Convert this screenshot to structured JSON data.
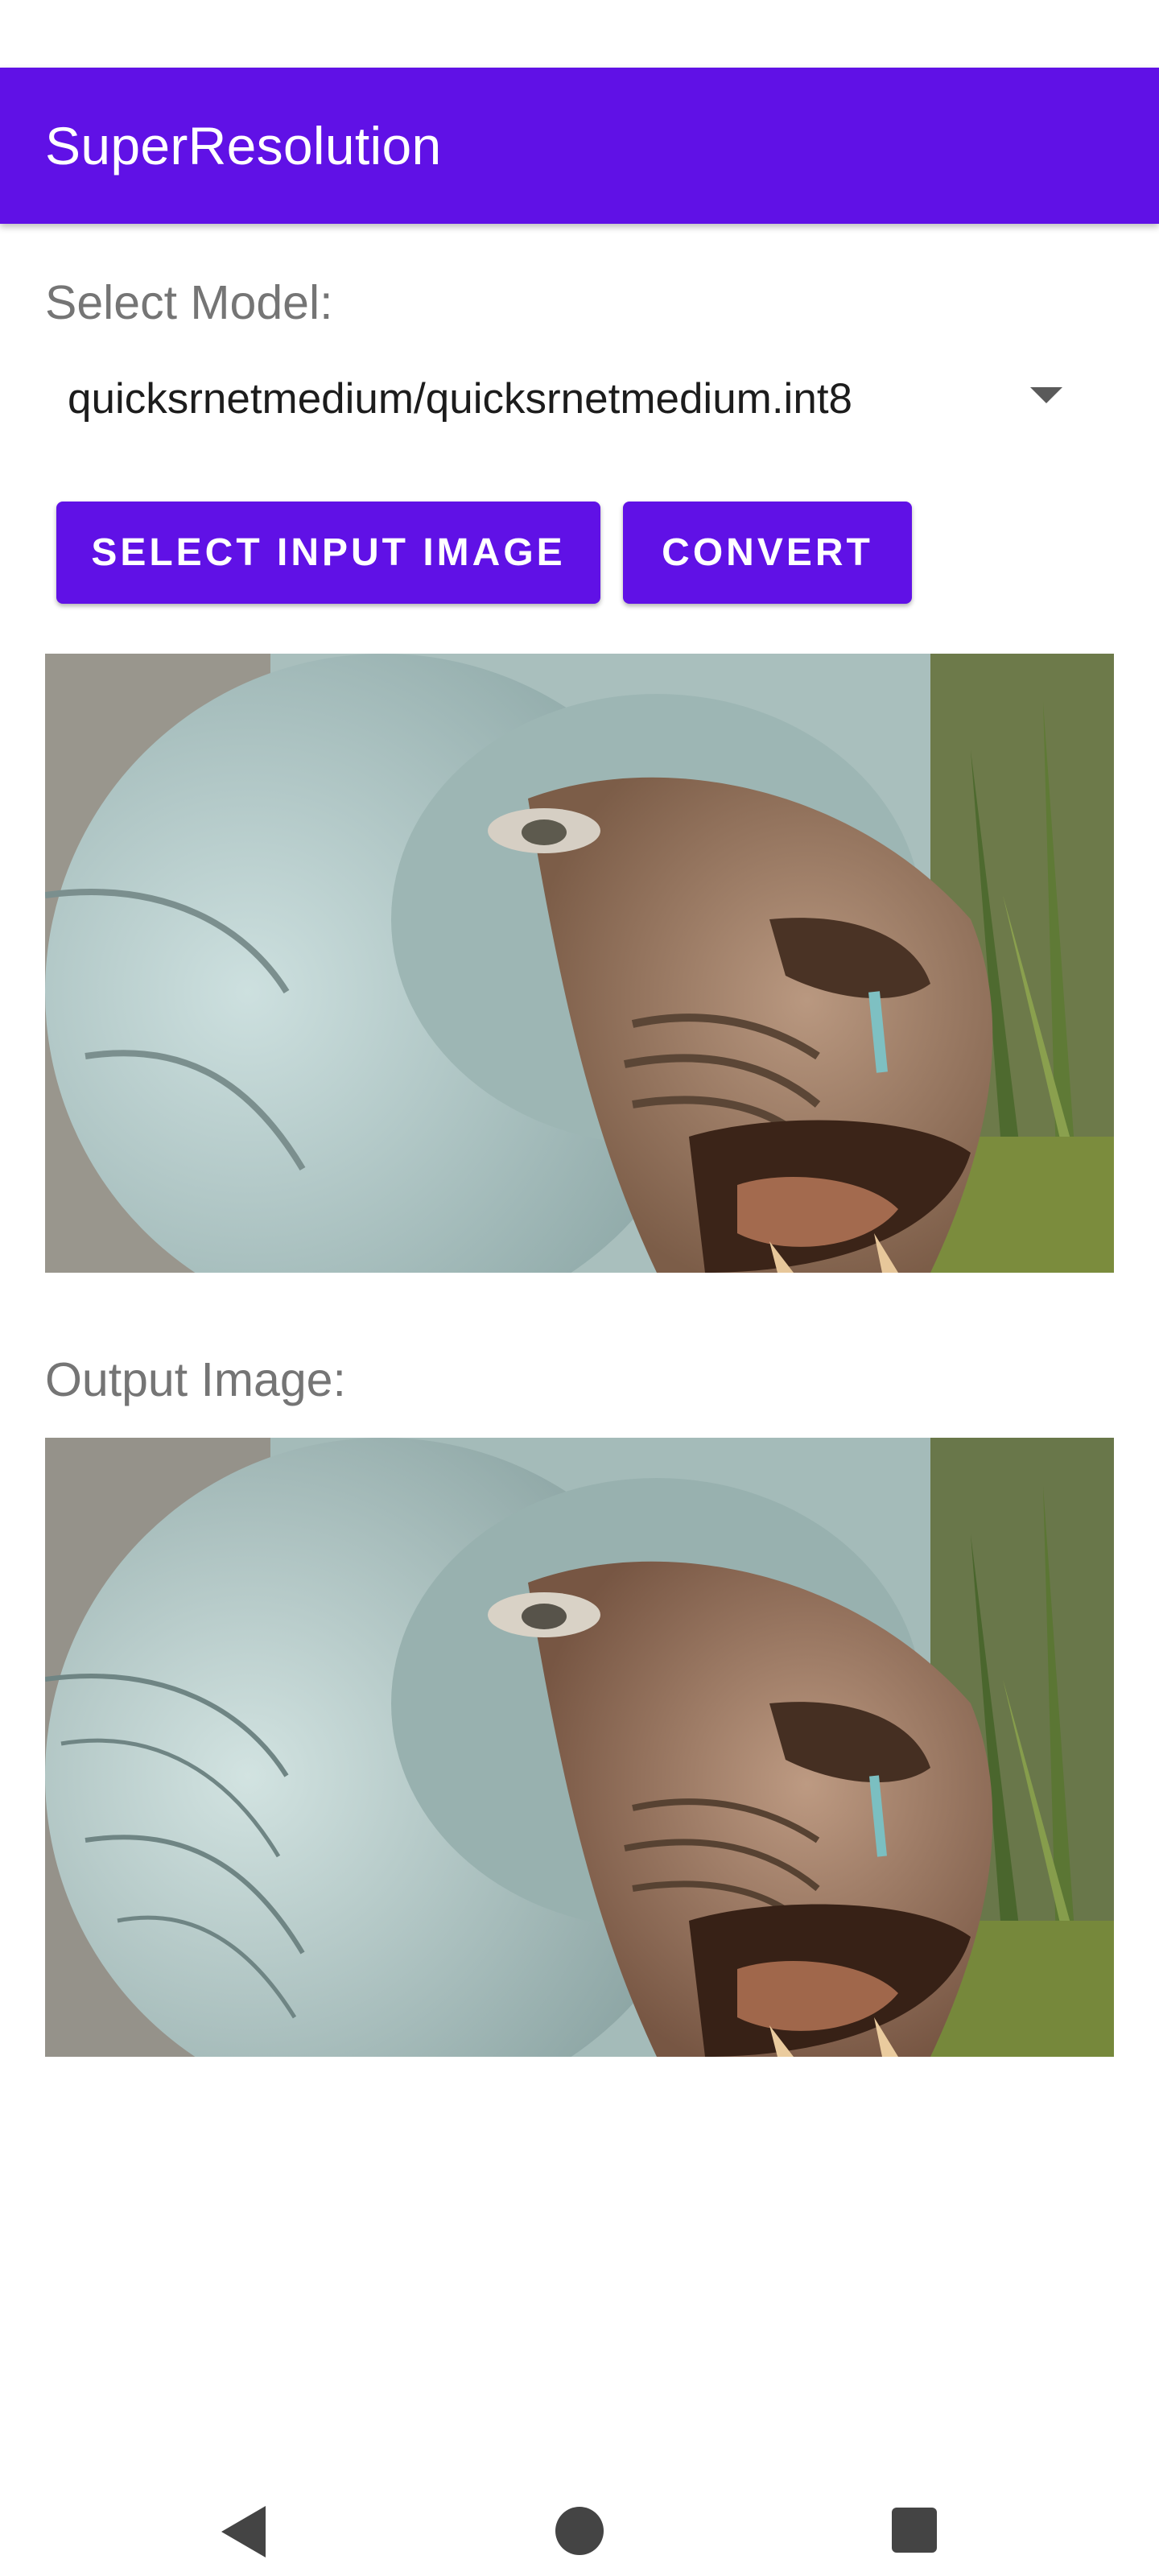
{
  "app_bar": {
    "title": "SuperResolution"
  },
  "model": {
    "label": "Select Model:",
    "selected": "quicksrnetmedium/quicksrnetmedium.int8"
  },
  "buttons": {
    "select_input": "SELECT INPUT IMAGE",
    "convert": "CONVERT"
  },
  "output": {
    "label": "Output Image:"
  },
  "icons": {
    "dropdown": "caret-down-icon",
    "nav_back": "back-triangle-icon",
    "nav_home": "home-circle-icon",
    "nav_recents": "recents-square-icon"
  },
  "colors": {
    "accent": "#6011e6",
    "label": "#757575",
    "text": "#1c1c1c"
  }
}
